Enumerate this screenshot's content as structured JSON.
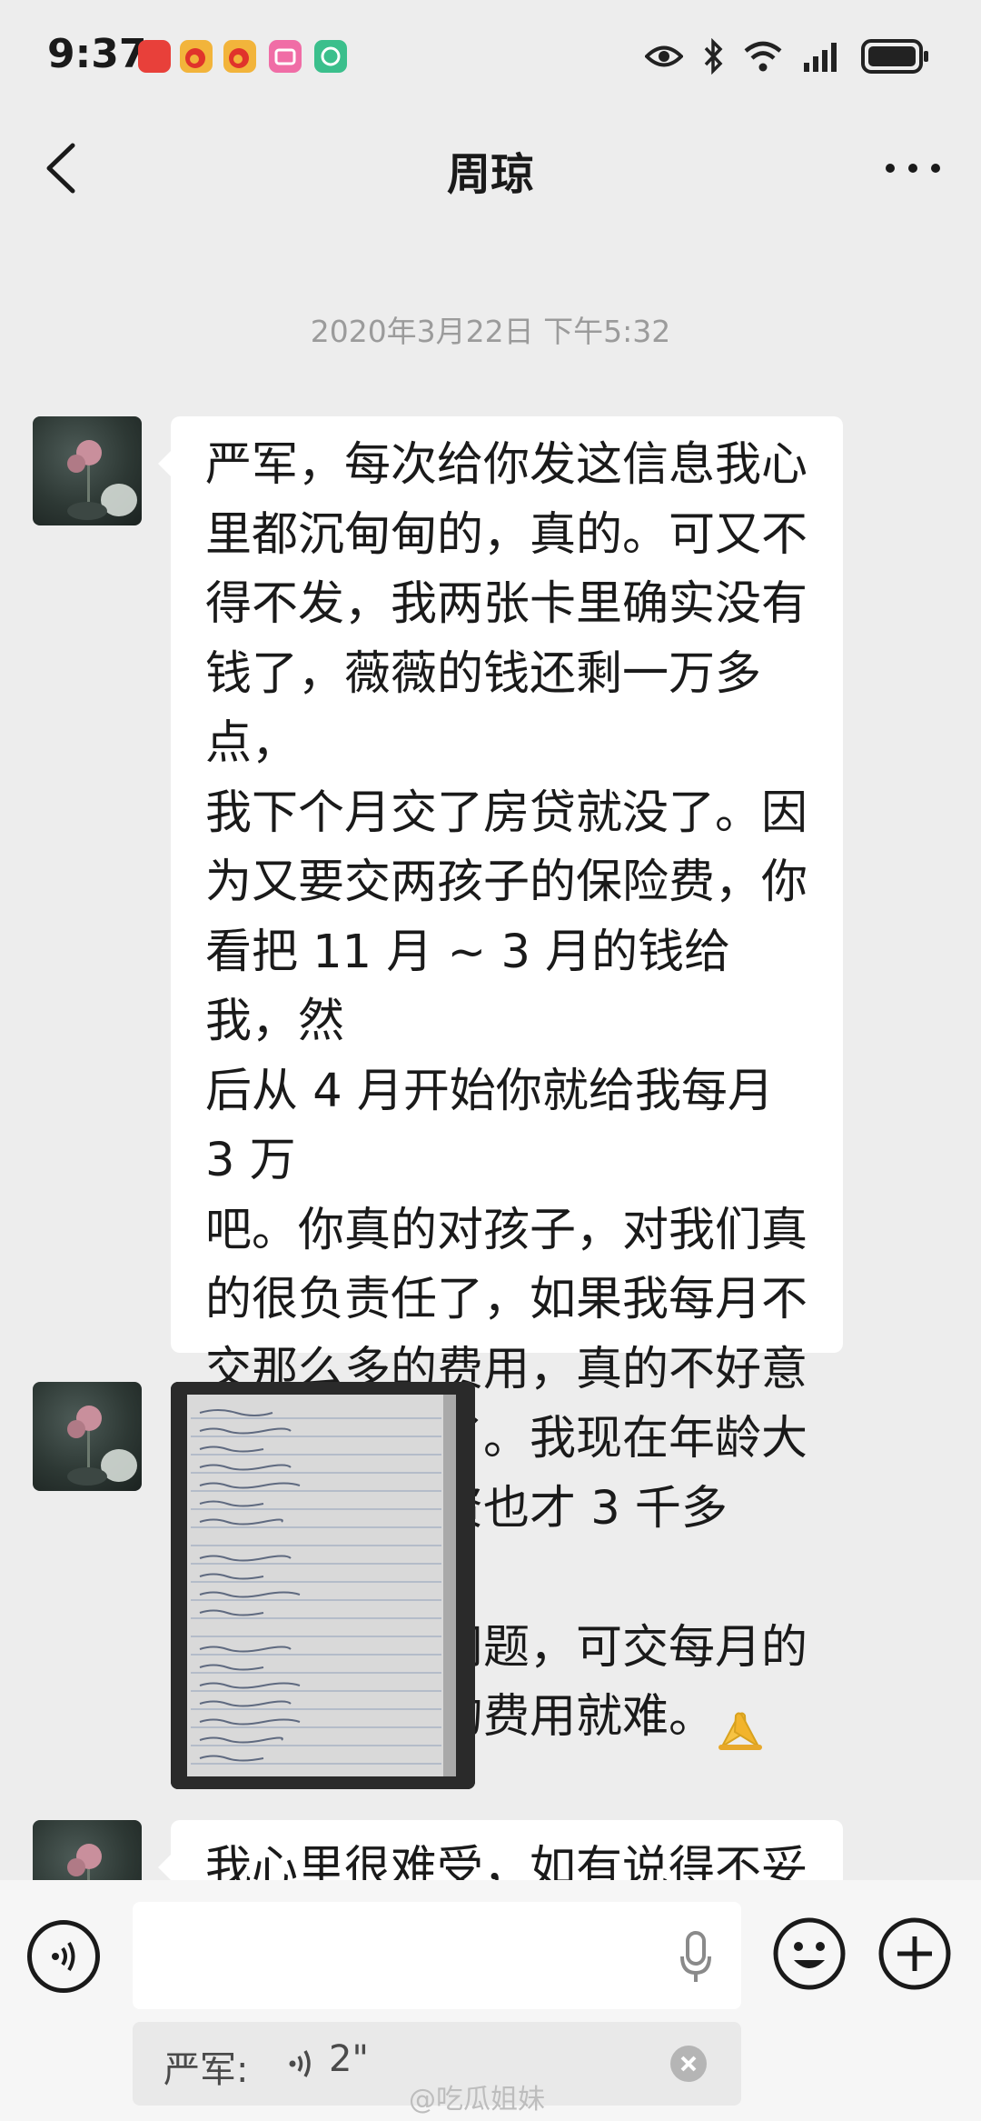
{
  "status_bar": {
    "time": "9:37",
    "app_icons": [
      {
        "name": "huawei-app-icon",
        "color": "#e8403a"
      },
      {
        "name": "weibo-icon",
        "color": "#f2b43b"
      },
      {
        "name": "weibo-lite-icon",
        "color": "#f2b43b"
      },
      {
        "name": "bilibili-icon",
        "color": "#f06da6"
      },
      {
        "name": "green-app-icon",
        "color": "#3bbf8c"
      }
    ],
    "indicators": [
      "eye-icon",
      "bluetooth-icon",
      "wifi-icon",
      "signal-icon",
      "battery-icon"
    ]
  },
  "nav": {
    "title": "周琼",
    "back_icon": "back-chevron-icon",
    "more_icon": "more-dots-icon"
  },
  "chat": {
    "timestamp": "2020年3月22日 下午5:32",
    "messages": [
      {
        "type": "text",
        "text": "严军，每次给你发这信息我心\n里都沉甸甸的，真的。可又不\n得不发，我两张卡里确实没有\n钱了，薇薇的钱还剩一万多点，\n我下个月交了房贷就没了。因\n为又要交两孩子的保险费，你\n看把 11 月 ~ 3 月的钱给我，然\n后从 4 月开始你就给我每月 3 万\n吧。你真的对孩子，对我们真\n的很负责任了，如果我每月不\n交那么多的费用，真的不好意\n思在拖累你了。我现在年龄大\n了，打工工资也才 3 千多点，自\n己的生活没问题，可交每月的\n房贷及其他的费用就难。",
        "emoji": "praying-hands-icon"
      },
      {
        "type": "image",
        "content": "photo of handwritten ledger notebook"
      },
      {
        "type": "text",
        "text": "我心里很难受，如有说得不妥"
      }
    ]
  },
  "input_bar": {
    "voice_icon": "voice-mode-icon",
    "mic_icon": "microphone-icon",
    "emoji_icon": "emoji-icon",
    "plus_icon": "plus-icon",
    "quote": {
      "sender": "严军:",
      "duration": "2\"",
      "voice_icon": "voice-wave-icon",
      "close_icon": "close-icon"
    }
  },
  "watermark": "@吃瓜姐妹"
}
